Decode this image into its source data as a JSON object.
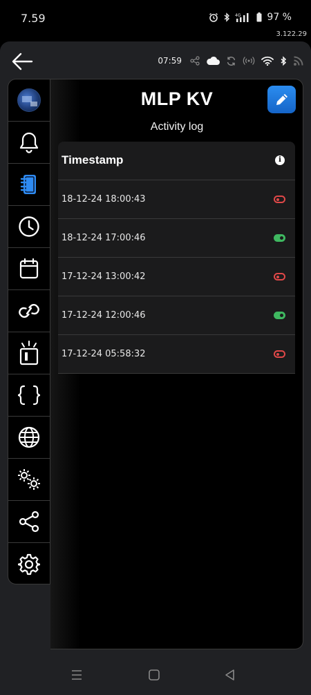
{
  "status_bar": {
    "time": "7.59",
    "battery": "97 %",
    "network": "4G",
    "icons": [
      "alarm-icon",
      "bluetooth-icon",
      "signal-icon",
      "battery-icon"
    ]
  },
  "app_version": "3.122.29",
  "top_bar": {
    "time": "07:59",
    "icons": [
      "back-arrow-icon",
      "share-icon",
      "cloud-icon",
      "sync-icon",
      "broadcast-icon",
      "wifi-icon",
      "bluetooth-icon",
      "rss-icon"
    ]
  },
  "sidebar": {
    "items": [
      {
        "name": "device",
        "icon": "device-thumbnail"
      },
      {
        "name": "alerts",
        "icon": "bell-icon"
      },
      {
        "name": "log",
        "icon": "notebook-icon",
        "active": true
      },
      {
        "name": "timers",
        "icon": "clock-icon"
      },
      {
        "name": "calendar",
        "icon": "calendar-icon"
      },
      {
        "name": "links",
        "icon": "link-icon"
      },
      {
        "name": "actuator",
        "icon": "beacon-icon"
      },
      {
        "name": "code",
        "icon": "braces-icon"
      },
      {
        "name": "network",
        "icon": "globe-icon"
      },
      {
        "name": "advanced",
        "icon": "gears-icon"
      },
      {
        "name": "share",
        "icon": "share-icon"
      },
      {
        "name": "settings",
        "icon": "gear-icon"
      }
    ]
  },
  "page": {
    "title": "MLP KV",
    "subtitle": "Activity log",
    "edit_icon": "pencil-icon"
  },
  "log_table": {
    "header": "Timestamp",
    "info_icon": "i",
    "rows": [
      {
        "timestamp": "18-12-24 18:00:43",
        "state": "off"
      },
      {
        "timestamp": "18-12-24 17:00:46",
        "state": "on"
      },
      {
        "timestamp": "17-12-24 13:00:42",
        "state": "off"
      },
      {
        "timestamp": "17-12-24 12:00:46",
        "state": "on"
      },
      {
        "timestamp": "17-12-24 05:58:32",
        "state": "off"
      }
    ]
  },
  "colors": {
    "accent": "#1e7ae0",
    "toggle_on": "#3fb860",
    "toggle_off": "#e04848",
    "background": "#000000",
    "frame": "#202124"
  },
  "nav_bar": {
    "icons": [
      "recent-apps-icon",
      "home-icon",
      "back-icon"
    ]
  }
}
